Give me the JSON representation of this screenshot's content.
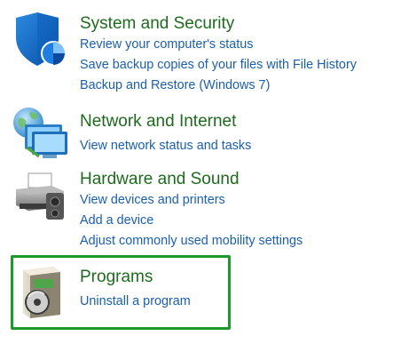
{
  "categories": {
    "system_security": {
      "title": "System and Security",
      "icon": "shield-icon",
      "links": [
        "Review your computer's status",
        "Save backup copies of your files with File History",
        "Backup and Restore (Windows 7)"
      ]
    },
    "network_internet": {
      "title": "Network and Internet",
      "icon": "network-globe-icon",
      "links": [
        "View network status and tasks"
      ]
    },
    "hardware_sound": {
      "title": "Hardware and Sound",
      "icon": "printer-icon",
      "links": [
        "View devices and printers",
        "Add a device",
        "Adjust commonly used mobility settings"
      ]
    },
    "programs": {
      "title": "Programs",
      "icon": "programs-disc-icon",
      "highlighted": true,
      "highlight_color": "#1a9a2a",
      "links": [
        "Uninstall a program"
      ]
    }
  },
  "colors": {
    "title_green": "#1e6b1e",
    "link_blue": "#1a5fb0"
  }
}
